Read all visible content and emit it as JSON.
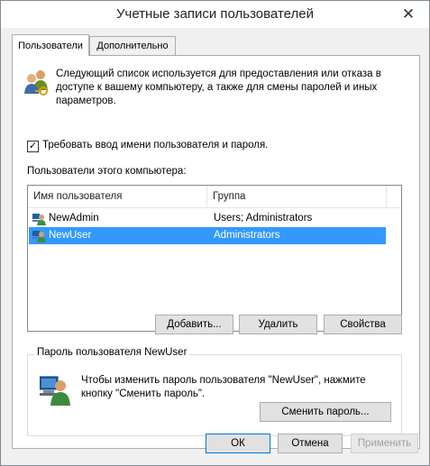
{
  "window": {
    "title": "Учетные записи пользователей",
    "close_glyph": "✕"
  },
  "tabs": [
    {
      "label": "Пользователи",
      "active": true
    },
    {
      "label": "Дополнительно",
      "active": false
    }
  ],
  "users_tab": {
    "description": "Следующий список используется для предоставления или отказа в доступе к вашему компьютеру, а также для смены паролей и иных параметров.",
    "require_login": {
      "label": "Требовать ввод имени пользователя и пароля.",
      "checked": true,
      "glyph": "✓"
    },
    "users_label": "Пользователи этого компьютера:",
    "columns": [
      "Имя пользователя",
      "Группа"
    ],
    "rows": [
      {
        "name": "NewAdmin",
        "group": "Users; Administrators",
        "selected": false
      },
      {
        "name": "NewUser",
        "group": "Administrators",
        "selected": true
      }
    ],
    "buttons": {
      "add": "Добавить...",
      "remove": "Удалить",
      "properties": "Свойства"
    },
    "password_group": {
      "title": "Пароль пользователя NewUser",
      "text": "Чтобы изменить пароль пользователя \"NewUser\", нажмите кнопку \"Сменить пароль\".",
      "change_button": "Сменить пароль..."
    }
  },
  "dialog_buttons": {
    "ok": "ОК",
    "cancel": "Отмена",
    "apply": "Применить"
  },
  "icons": {
    "users": "users-keys-icon",
    "user": "user-icon",
    "password": "computer-user-icon"
  },
  "colors": {
    "selection": "#3399ff",
    "default_border": "#0078d7"
  }
}
